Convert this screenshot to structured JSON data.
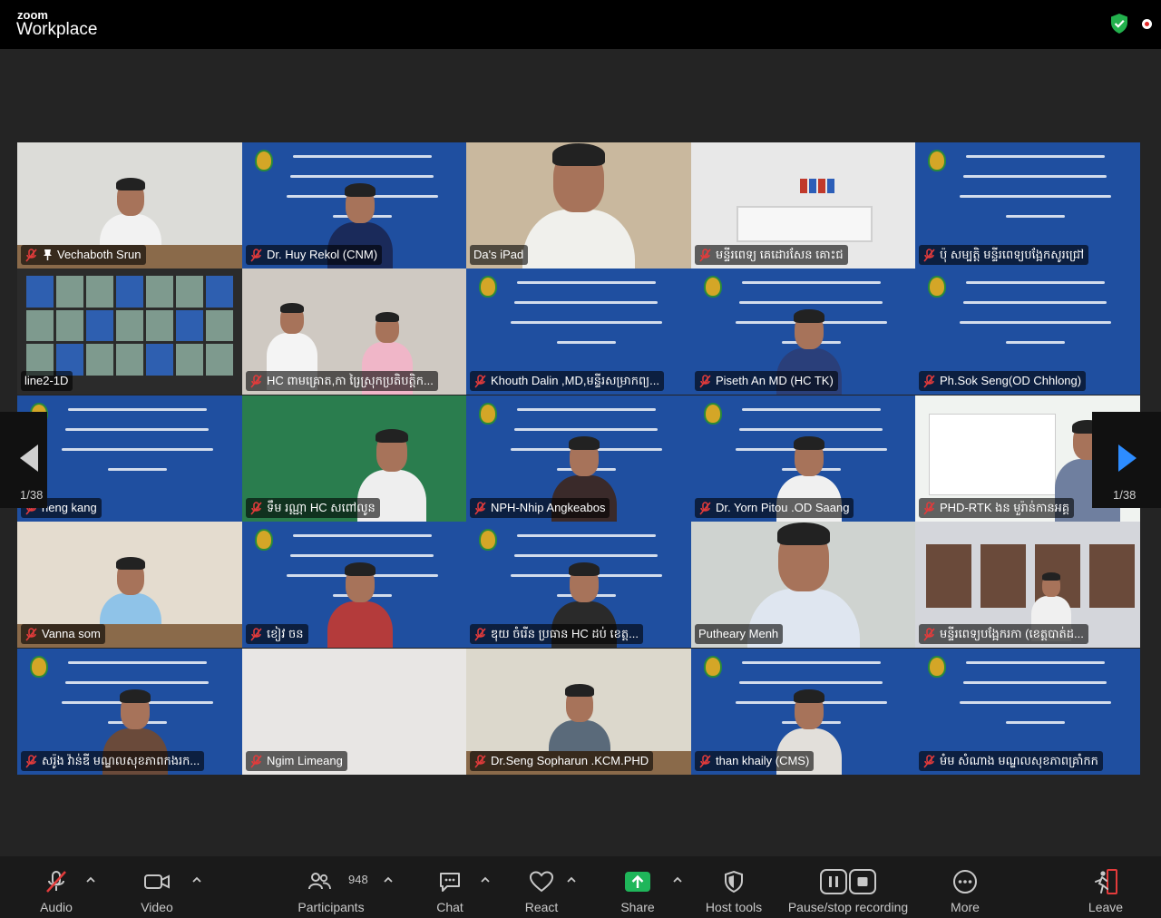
{
  "app": {
    "brand_small": "zoom",
    "brand_big": "Workplace"
  },
  "colors": {
    "active_speaker": "#23d959",
    "muted_red": "#e33b3b",
    "share_green": "#1fb65a",
    "leave_red": "#e33b3b",
    "banner_blue": "#1f4fa0"
  },
  "pagination": {
    "left": "1/38",
    "right": "1/38"
  },
  "participants": [
    {
      "name": "Vechaboth Srun",
      "pinned": true,
      "muted": true,
      "active": false
    },
    {
      "name": "Dr. Huy Rekol (CNM)",
      "pinned": false,
      "muted": true,
      "active": false
    },
    {
      "name": "Da's iPad",
      "pinned": false,
      "muted": false,
      "active": true
    },
    {
      "name": "មន្ទីរពេទ្យ គេដោរសែន គោះជ",
      "pinned": false,
      "muted": true,
      "active": false
    },
    {
      "name": "ប៉ុ សម្បត្តិ មន្ទីរពេទ្យបង្អែកសូរជ្រៅ",
      "pinned": false,
      "muted": true,
      "active": false
    },
    {
      "name": "line2-1D",
      "pinned": false,
      "muted": false,
      "active": false
    },
    {
      "name": "HC ពាមគ្រោត,កា រ្រៃស្រុកប្រតិបត្តិក...",
      "pinned": false,
      "muted": true,
      "active": false
    },
    {
      "name": "Khouth Dalin ,MD,មន្ទីរសម្រាកព្យ...",
      "pinned": false,
      "muted": true,
      "active": false
    },
    {
      "name": "Piseth An MD (HC TK)",
      "pinned": false,
      "muted": true,
      "active": false
    },
    {
      "name": "Ph.Sok Seng(OD Chhlong)",
      "pinned": false,
      "muted": true,
      "active": false
    },
    {
      "name": "neng kang",
      "pinned": false,
      "muted": true,
      "active": false
    },
    {
      "name": "ទឹម រណ្ណា HC សពៅលូន",
      "pinned": false,
      "muted": true,
      "active": false
    },
    {
      "name": "NPH-Nhip Angkeabos",
      "pinned": false,
      "muted": true,
      "active": false
    },
    {
      "name": "Dr. Yorn Pitou .OD Saang",
      "pinned": false,
      "muted": true,
      "active": false
    },
    {
      "name": "PHD-RTK ងន មួរ៉ាន់កានអគ្គ",
      "pinned": false,
      "muted": true,
      "active": false
    },
    {
      "name": "Vanna som",
      "pinned": false,
      "muted": true,
      "active": false
    },
    {
      "name": "ខៀវ ចន",
      "pinned": false,
      "muted": true,
      "active": false
    },
    {
      "name": "ឌុយ ចំរើន ប្រធាន HC ដប់ ខេត្ត...",
      "pinned": false,
      "muted": true,
      "active": false
    },
    {
      "name": "Putheary Menh",
      "pinned": false,
      "muted": false,
      "active": false
    },
    {
      "name": "មន្ទីរពេទ្យបង្អែករកា (ខេត្តបាត់ដ...",
      "pinned": false,
      "muted": true,
      "active": false
    },
    {
      "name": "សរ៉ូង វ៉ាន់ឌី មណ្ឌលសុខភាពកងរក...",
      "pinned": false,
      "muted": true,
      "active": false
    },
    {
      "name": "Ngim Limeang",
      "pinned": false,
      "muted": true,
      "active": false
    },
    {
      "name": "Dr.Seng Sopharun .KCM.PHD",
      "pinned": false,
      "muted": true,
      "active": false
    },
    {
      "name": "than khaily (CMS)",
      "pinned": false,
      "muted": true,
      "active": false
    },
    {
      "name": "មំម សំណាង មណ្ឌលសុខភាពគ្រាំកក",
      "pinned": false,
      "muted": true,
      "active": false
    }
  ],
  "toolbar": {
    "audio": "Audio",
    "video": "Video",
    "participants": "Participants",
    "participants_count": "948",
    "chat": "Chat",
    "react": "React",
    "share": "Share",
    "host_tools": "Host tools",
    "recording": "Pause/stop recording",
    "more": "More",
    "leave": "Leave"
  }
}
